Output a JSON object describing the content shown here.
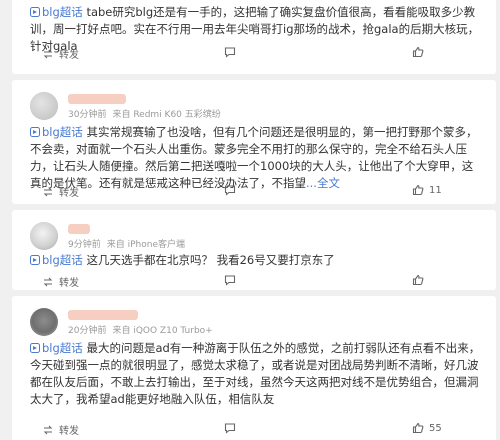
{
  "posts": [
    {
      "time": "",
      "source": "",
      "tag": "blg超话",
      "text": " tabe研究blg还是有一手的，这把输了确实复盘价值很高，看看能吸取多少教训，周一打好点吧。实在不行用一用去年尖哨哥打ig那场的战术，抢gala的后期大核玩，针对gala",
      "more": "",
      "repost": "转发",
      "comments": "",
      "likes": ""
    },
    {
      "time": "30分钟前",
      "source": "来自 Redmi K60 五彩缤纷",
      "tag": "blg超话",
      "text": " 其实常规赛输了也没啥，但有几个问题还是很明显的，第一把打野那个蒙多，不会卖，对面就一个石头人出重伤。蒙多完全不用打的那么保守的，完全不给石头人压力，让石头人随便撞。然后第二把送嘎啦一个1000块的大人头，让他出了个大穿甲，这真的是伏笔。还有就是惩戒这种已经没办法了，不指望",
      "more": "...全文",
      "repost": "转发",
      "comments": "",
      "likes": "11"
    },
    {
      "time": "9分钟前",
      "source": "来自 iPhone客户端",
      "tag": "blg超话",
      "text": " 这几天选手都在北京吗？ 我看26号又要打京东了",
      "more": "",
      "repost": "转发",
      "comments": "",
      "likes": ""
    },
    {
      "time": "20分钟前",
      "source": "来自 iQOO Z10 Turbo+",
      "tag": "blg超话",
      "text": " 最大的问题是ad有一种游离于队伍之外的感觉，之前打弱队还有点看不出来，今天碰到强一点的就很明显了，感觉太求稳了，或者说是对团战局势判断不清晰，好几波都在队友后面，不敢上去打输出，至于对线，虽然今天这两把对线不是优势组合，但漏洞太大了，我希望ad能更好地融入队伍，相信队友",
      "more": "",
      "repost": "转发",
      "comments": "",
      "likes": "55"
    }
  ],
  "icons": {
    "tag": "super-topic-icon",
    "repost": "repost-icon",
    "comment": "comment-icon",
    "like": "like-icon"
  },
  "colors": {
    "link": "#4a7bd1",
    "name_blur": "#f6c6b7",
    "background": "#f0f0f0"
  }
}
